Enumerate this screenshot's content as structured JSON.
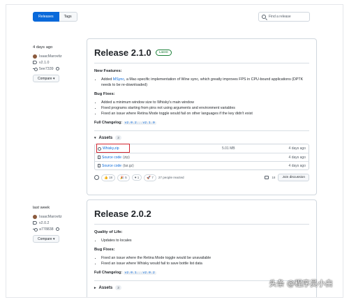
{
  "topbar": {
    "releases_tab": "Releases",
    "tags_tab": "Tags",
    "find_placeholder": "Find a release"
  },
  "release1": {
    "time": "4 days ago",
    "author": "IsaacMarovitz",
    "tag": "v2.1.0",
    "commit": "5ee7339",
    "compare": "Compare",
    "title": "Release 2.1.0",
    "badge": "Latest",
    "section1": "New Features:",
    "features_prefix": "Added ",
    "features_link": "MSync",
    "features_text": ", a Mac-specific implementation of Wine sync, which greatly improves FPS in CPU-bound applications (DPTK needs to be re-downloaded)",
    "section2": "Bug Fixes:",
    "fixes": [
      "Added a minimum window size to Whisky's main window",
      "Fixed programs starting from pins not using arguments and environment variables",
      "Fixed an issue where Retina Mode toggle would fail on other languages if the key didn't exist"
    ],
    "changelog_label": "Full Changelog:",
    "changelog_code": "v2.0.2...v2.1.0",
    "assets_label": "Assets",
    "assets_count": "3",
    "assets": [
      {
        "name": "Whisky.zip",
        "size": "5.01 MB",
        "date": "4 days ago"
      },
      {
        "name": "Source code",
        "ext": "(zip)",
        "size": "",
        "date": "4 days ago"
      },
      {
        "name": "Source code",
        "ext": "(tar.gz)",
        "size": "",
        "date": "4 days ago"
      }
    ],
    "reactions": {
      "thumbs": "18",
      "hooray": "5",
      "heart": "1",
      "rocket": "7",
      "people": "27 people reacted"
    },
    "comments": "18",
    "join": "Join discussion"
  },
  "release2": {
    "time": "last week",
    "author": "IsaacMarovitz",
    "tag": "v2.0.2",
    "commit": "a778838",
    "compare": "Compare",
    "title": "Release 2.0.2",
    "section1": "Quality of Life:",
    "qol": [
      "Updates to locales"
    ],
    "section2": "Bug Fixes:",
    "fixes": [
      "Fixed an issue where the Retina Mode toggle would be unavailable",
      "Fixed an issue where Whisky would fail to save bottle list data"
    ],
    "changelog_label": "Full Changelog:",
    "changelog_code": "v2.0.1...v2.0.2",
    "assets_label": "Assets",
    "assets_count": "3"
  },
  "watermark": "头条 @程序员小白"
}
